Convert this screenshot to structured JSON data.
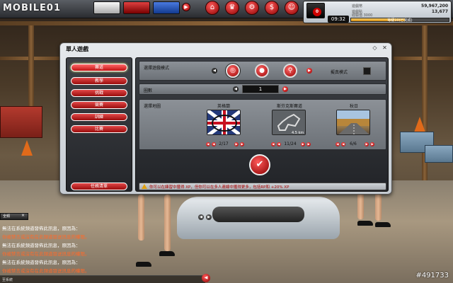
{
  "topbar": {
    "logo": "MOBILE01",
    "car_thumbs": [
      {
        "name": "car-thumb-white",
        "color": "#e8e8e8"
      },
      {
        "name": "car-thumb-red",
        "color": "#c02020"
      },
      {
        "name": "car-thumb-blue",
        "color": "#2050c0"
      }
    ],
    "nav_buttons": [
      {
        "name": "home-button",
        "icon": "⌂"
      },
      {
        "name": "trophy-button",
        "icon": "♛"
      },
      {
        "name": "garage-button",
        "icon": "⚙"
      },
      {
        "name": "shop-button",
        "icon": "$"
      },
      {
        "name": "community-button",
        "icon": "☺"
      },
      {
        "name": "settings-button",
        "icon": "✱"
      }
    ]
  },
  "status": {
    "avatar_badge": "0",
    "clock": "09:32",
    "stats": [
      {
        "label": "遊戲幣",
        "value": "59,967,200"
      },
      {
        "label": "遊戲點",
        "value": "13,677"
      }
    ],
    "xp_label": "經驗值 3000",
    "xp_fraction": 0.55,
    "xp_text": "等級10(已完成)"
  },
  "dialog": {
    "title": "單人遊戲",
    "menu": [
      {
        "label": "賽道",
        "active": true
      },
      {
        "label": "教學",
        "active": false
      },
      {
        "label": "挑戰",
        "active": false
      },
      {
        "label": "競賽",
        "active": false
      },
      {
        "label": "訓練",
        "active": false
      },
      {
        "label": "比賽",
        "active": false
      }
    ],
    "mission_button": "任務清單",
    "mode_row": {
      "label": "選擇遊戲模式",
      "modes": [
        "◎",
        "●",
        "⚲"
      ],
      "realism_label": "擬真模式"
    },
    "rounds_row": {
      "label": "圈數",
      "value": "1"
    },
    "maps_row": {
      "label": "選擇地圖",
      "maps": [
        {
          "name": "英格蘭",
          "count": "2/17"
        },
        {
          "name": "斯芬克斯賽道",
          "count": "11/24"
        },
        {
          "name": "秋日",
          "count": "6/6"
        }
      ],
      "track_length": "4.5 km"
    },
    "start_icon": "✔",
    "info_text": "你可以在練習中獲得 XP，但你可以在多人連線中獲得更多，包括RP和 +20% XP"
  },
  "chat": {
    "tab_label": "全頻",
    "lines": [
      {
        "text": "無法在系統頻道發佈此訊息，原因為：",
        "color": "#ffffff"
      },
      {
        "text": "你被禁言或沒有在此頻道發送訊息的權限。",
        "color": "#ff6a2a"
      },
      {
        "text": "無法在系統頻道發佈此訊息，原因為：",
        "color": "#ffffff"
      },
      {
        "text": "你被禁言或沒有在此頻道發送訊息的權限。",
        "color": "#ff6a2a"
      },
      {
        "text": "無法在系統頻道發佈此訊息，原因為：",
        "color": "#ffffff"
      },
      {
        "text": "你被禁言或沒有在此頻道發送訊息的權限。",
        "color": "#ff6a2a"
      }
    ],
    "input_label": "至系統"
  },
  "watermark": "#491733"
}
